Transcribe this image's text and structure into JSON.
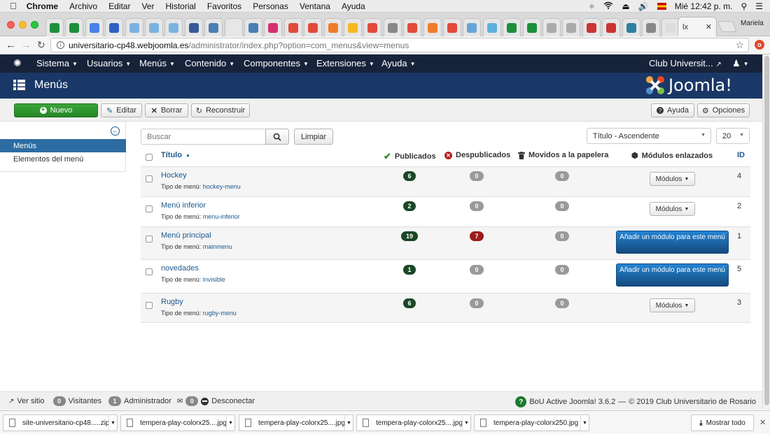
{
  "os_menu": {
    "app": "Chrome",
    "items": [
      "Archivo",
      "Editar",
      "Ver",
      "Historial",
      "Favoritos",
      "Personas",
      "Ventana",
      "Ayuda"
    ],
    "clock": "Mié 12:42 p. m."
  },
  "browser": {
    "profile": "Mariela",
    "active_tab_title": "lx",
    "url_host": "universitario-cp48.webjoomla.es",
    "url_path": "/administrator/index.php?option=com_menus&view=menus"
  },
  "jnav": {
    "items": [
      "Sistema",
      "Usuarios",
      "Menús",
      "Contenido",
      "Componentes",
      "Extensiones",
      "Ayuda"
    ],
    "site_link": "Club Universit..."
  },
  "header": {
    "title": "Menús",
    "logo_text": "Joomla!"
  },
  "toolbar": {
    "new": "Nuevo",
    "edit": "Editar",
    "delete": "Borrar",
    "rebuild": "Reconstruir",
    "help": "Ayuda",
    "options": "Opciones"
  },
  "sidebar": {
    "items": [
      "Menús",
      "Elementos del menú"
    ]
  },
  "filters": {
    "search_placeholder": "Buscar",
    "clear": "Limpiar",
    "sort": "Título - Ascendente",
    "limit": "20"
  },
  "table": {
    "headers": {
      "title": "Título",
      "published": "Publicados",
      "unpublished": "Despublicados",
      "trashed": "Movidos a la papelera",
      "modules": "Módulos enlazados",
      "id": "ID"
    },
    "type_label": "Tipo de menú:",
    "modules_button": "Módulos",
    "add_module": "Añadir un módulo para este menú",
    "rows": [
      {
        "title": "Hockey",
        "type": "hockey-menu",
        "published": "6",
        "unpublished": "0",
        "trashed": "0",
        "id": "4"
      },
      {
        "title": "Menú inferior",
        "type": "menu-inferior",
        "published": "2",
        "unpublished": "0",
        "trashed": "0",
        "id": "2"
      },
      {
        "title": "Menú principal",
        "type": "mainmenu",
        "published": "19",
        "unpublished": "7",
        "trashed": "0",
        "id": "1"
      },
      {
        "title": "novedades",
        "type": "invisible",
        "published": "1",
        "unpublished": "0",
        "trashed": "0",
        "id": "5"
      },
      {
        "title": "Rugby",
        "type": "rugby-menu",
        "published": "6",
        "unpublished": "0",
        "trashed": "0",
        "id": "3"
      }
    ]
  },
  "footer": {
    "view_site": "Ver sitio",
    "visitors_count": "0",
    "visitors": "Visitantes",
    "admins_count": "1",
    "admins": "Administrador",
    "messages_count": "0",
    "logout": "Desconectar",
    "version": "BoU Active Joomla! 3.6.2",
    "dash": "—",
    "copyright": "© 2019 Club Universitario de Rosario"
  },
  "downloads": {
    "files": [
      "site-universitario-cp48.....zip",
      "tempera-play-colorx25....jpg",
      "tempera-play-colorx25....jpg",
      "tempera-play-colorx25....jpg",
      "tempera-play-colorx250.jpg"
    ],
    "show_all": "Mostrar todo"
  },
  "colors": {
    "joomla_nav": "#17233a",
    "joomla_header": "#1a3867",
    "new_button": "#2f9a2f",
    "link": "#1e5a8e",
    "badge_published": "#1a4726",
    "badge_unpublished": "#9b1c1c",
    "badge_zero": "#9a9a9a",
    "module_button": "#1c6bb0"
  }
}
